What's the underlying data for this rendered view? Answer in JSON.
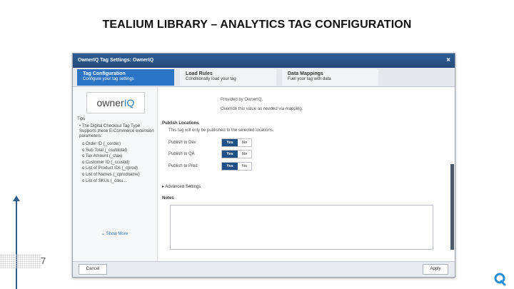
{
  "slide": {
    "title": "TEALIUM LIBRARY – ANALYTICS TAG CONFIGURATION",
    "page_number": "7"
  },
  "dialog": {
    "title": "OwnerIQ Tag Settings: OwnerIQ",
    "close_glyph": "×",
    "tabs": [
      {
        "label": "Tag Configuration",
        "sub": "Configure your tag settings",
        "active": true
      },
      {
        "label": "Load Rules",
        "sub": "Conditionally load your tag",
        "active": false
      },
      {
        "label": "Data Mappings",
        "sub": "Fuel your tag with data",
        "active": false
      }
    ],
    "sidebar": {
      "logo_owner": "owner",
      "logo_iq": "IQ",
      "tips_label": "Tips",
      "tip_intro": "• The Digital Checkout Tag Type Supports these E-Commerce extension parameters:",
      "tip_items": [
        "o  Order ID (_corder)",
        "o  Sub Total (_csubtotal)",
        "o  Tax Amount (_ctax)",
        "o  Customer ID (_ccustid)",
        "o  List of Product IDs (_cprod)",
        "o  List of Names (_cprodname)",
        "o  List of SKUs (_csku..."
      ],
      "show_more": "⌄ Show More"
    },
    "main": {
      "provided_by": "Provided by OwnerIQ.",
      "override_note": "Override this value as needed via mapping.",
      "publish_heading": "Publish Locations",
      "publish_note": "This tag will only be published to the selected locations.",
      "publish_rows": [
        {
          "label": "Publish to Dev",
          "yes": "Yes",
          "no": "No"
        },
        {
          "label": "Publish to QA",
          "yes": "Yes",
          "no": "No"
        },
        {
          "label": "Publish to Prod",
          "yes": "Yes",
          "no": "No"
        }
      ],
      "advanced": "▸ Advanced Settings",
      "notes_label": "Notes",
      "notes_value": ""
    },
    "footer": {
      "cancel": "Cancel",
      "apply": "Apply"
    }
  },
  "colors": {
    "accent": "#2a73c5",
    "titlebar": "#24497a",
    "yes_selected": "#1f4f84"
  },
  "icons": [
    "close-icon",
    "ownerq-logo-icon",
    "chevron-down-icon",
    "caret-right-icon",
    "resize-grip-icon"
  ]
}
